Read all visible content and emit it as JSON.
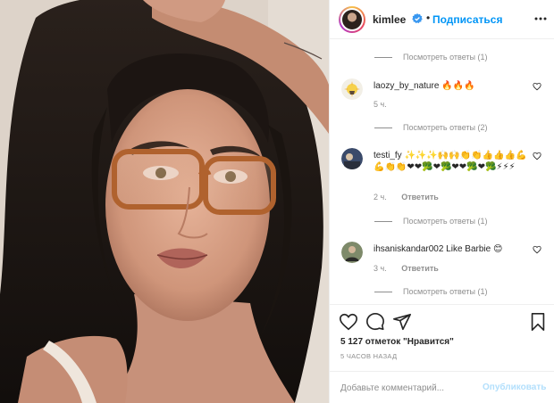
{
  "photo": {
    "description_icon": "portrait-photo"
  },
  "header": {
    "username": "kimlee",
    "separator": "•",
    "follow_label": "Подписаться",
    "verified_icon": "verified-badge-icon",
    "more_icon": "more-options-icon"
  },
  "comments": {
    "replies_1": "Посмотреть ответы (1)",
    "items": [
      {
        "author": "laozy_by_nature",
        "text": "🔥🔥🔥",
        "time": "5 ч.",
        "reply_label": "",
        "replies": "Посмотреть ответы (2)"
      },
      {
        "author": "testi_fy",
        "text": "✨✨✨🙌🙌👏👏👍👍👍💪💪👏👏❤❤🥦❤🥦❤❤🥦❤🥦⚡⚡⚡",
        "time": "2 ч.",
        "reply_label": "Ответить",
        "replies": "Посмотреть ответы (1)"
      },
      {
        "author": "ihsaniskandar002",
        "text": "Like Barbie 😊",
        "time": "3 ч.",
        "reply_label": "Ответить",
        "replies": "Посмотреть ответы (1)"
      }
    ]
  },
  "actions": {
    "likes": "5 127 отметок \"Нравится\"",
    "time_ago": "5 ЧАСОВ НАЗАД",
    "add_comment_placeholder": "Добавьте комментарий...",
    "publish_label": "Опубликовать"
  },
  "colors": {
    "accent": "#0095f6",
    "muted": "#8e8e8e",
    "border": "#efefef"
  }
}
